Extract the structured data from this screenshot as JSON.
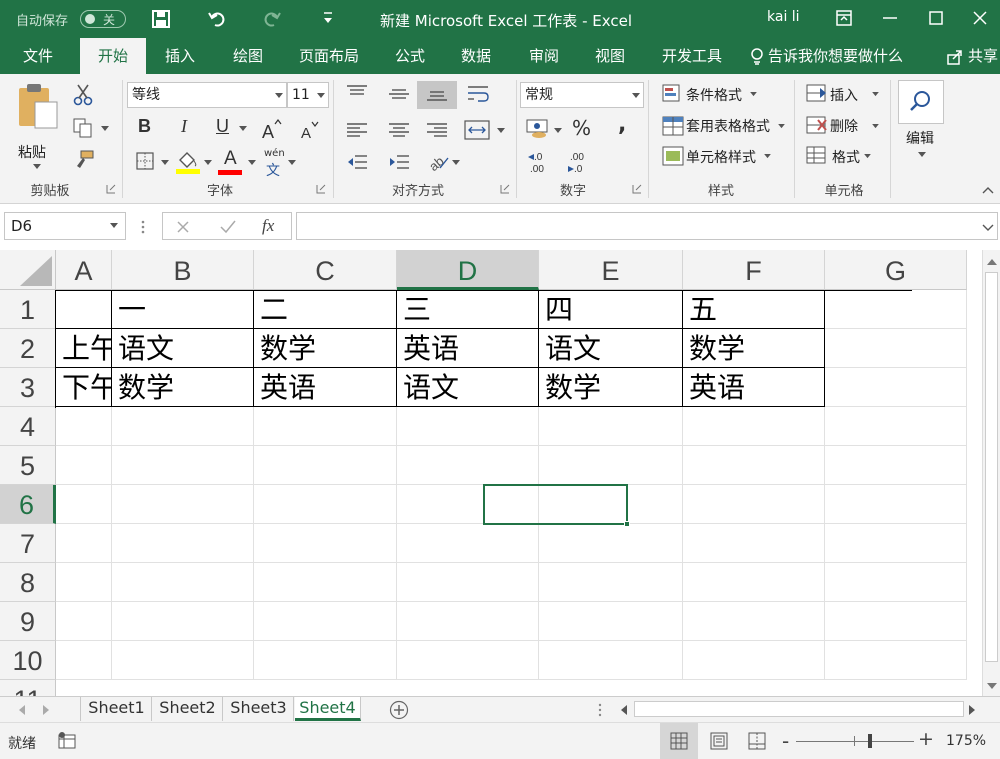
{
  "title_bar": {
    "autosave_label": "自动保存",
    "autosave_state": "关",
    "document_title": "新建 Microsoft Excel 工作表  -  Excel",
    "user_name": "kai li"
  },
  "ribbon_tabs": [
    "文件",
    "开始",
    "插入",
    "绘图",
    "页面布局",
    "公式",
    "数据",
    "审阅",
    "视图",
    "开发工具"
  ],
  "tell_me": "告诉我你想要做什么",
  "share_label": "共享",
  "ribbon": {
    "clipboard": {
      "paste_label": "粘贴",
      "group_label": "剪贴板"
    },
    "font": {
      "font_name": "等线",
      "font_size": "11",
      "group_label": "字体",
      "phonetic_label": "wén",
      "phonetic_char": "文",
      "bold": "B",
      "italic": "I",
      "underline": "U",
      "font_color_letter": "A"
    },
    "alignment": {
      "group_label": "对齐方式"
    },
    "number": {
      "format": "常规",
      "group_label": "数字",
      "percent": "%",
      "comma": ","
    },
    "styles": {
      "conditional_format": "条件格式",
      "table_format": "套用表格格式",
      "cell_styles": "单元格样式",
      "group_label": "样式"
    },
    "cells": {
      "insert": "插入",
      "delete": "删除",
      "format": "格式",
      "group_label": "单元格"
    },
    "editing": {
      "label": "编辑"
    }
  },
  "formula_bar": {
    "name_box": "D6",
    "fx": "fx",
    "content": ""
  },
  "sheet": {
    "columns": [
      "A",
      "B",
      "C",
      "D",
      "E",
      "F",
      "G"
    ],
    "rows": [
      "1",
      "2",
      "3",
      "4",
      "5",
      "6",
      "7",
      "8",
      "9",
      "10"
    ],
    "cells": [
      [
        "",
        "一",
        "二",
        "三",
        "四",
        "五"
      ],
      [
        "上午",
        "语文",
        "数学",
        "英语",
        "语文",
        "数学"
      ],
      [
        "下午",
        "数学",
        "英语",
        "语文",
        "数学",
        "英语"
      ]
    ],
    "selected_column": "D",
    "selected_row": "6"
  },
  "sheet_tabs": [
    "Sheet1",
    "Sheet2",
    "Sheet3",
    "Sheet4"
  ],
  "active_sheet": "Sheet4",
  "status": {
    "ready": "就绪",
    "zoom": "175%",
    "zoom_minus": "-",
    "zoom_plus": "+"
  },
  "colors": {
    "accent": "#217346",
    "ribbon_bg": "#f3f3f3"
  }
}
